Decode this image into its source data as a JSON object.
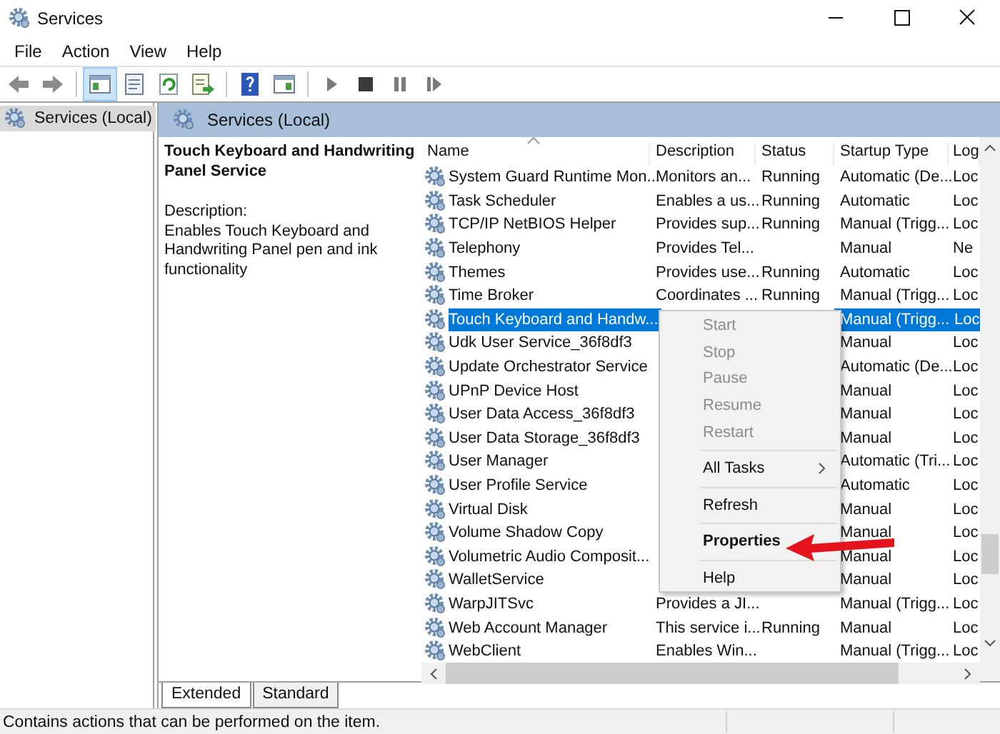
{
  "window": {
    "title": "Services"
  },
  "menu_bar": [
    "File",
    "Action",
    "View",
    "Help"
  ],
  "toolbar": [
    {
      "kind": "back",
      "selected": false
    },
    {
      "kind": "forward",
      "selected": false
    },
    {
      "kind": "sep"
    },
    {
      "kind": "tree",
      "selected": true
    },
    {
      "kind": "props",
      "selected": false
    },
    {
      "kind": "refresh",
      "selected": false
    },
    {
      "kind": "export",
      "selected": false
    },
    {
      "kind": "sep"
    },
    {
      "kind": "help",
      "selected": false
    },
    {
      "kind": "pane",
      "selected": false
    },
    {
      "kind": "sep"
    },
    {
      "kind": "play",
      "selected": false
    },
    {
      "kind": "stop",
      "selected": false
    },
    {
      "kind": "pause",
      "selected": false
    },
    {
      "kind": "resume",
      "selected": false
    }
  ],
  "tree": [
    {
      "label": "Services (Local)",
      "selected": true
    }
  ],
  "panel": {
    "title": "Services (Local)"
  },
  "details": {
    "service_name": "Touch Keyboard and Handwriting Panel Service",
    "description_label": "Description:",
    "description": "Enables Touch Keyboard and Handwriting Panel pen and ink functionality"
  },
  "table": {
    "columns": [
      {
        "label": "Name",
        "sorted": true
      },
      {
        "label": "Description",
        "sorted": false
      },
      {
        "label": "Status",
        "sorted": false
      },
      {
        "label": "Startup Type",
        "sorted": false
      },
      {
        "label": "Log",
        "sorted": false
      }
    ],
    "rows": [
      {
        "name": "System Guard Runtime Mon...",
        "description": "Monitors an...",
        "status": "Running",
        "startup": "Automatic (De...",
        "logon": "Loc",
        "selected": false
      },
      {
        "name": "Task Scheduler",
        "description": "Enables a us...",
        "status": "Running",
        "startup": "Automatic",
        "logon": "Loc",
        "selected": false
      },
      {
        "name": "TCP/IP NetBIOS Helper",
        "description": "Provides sup...",
        "status": "Running",
        "startup": "Manual (Trigg...",
        "logon": "Loc",
        "selected": false
      },
      {
        "name": "Telephony",
        "description": "Provides Tel...",
        "startup": "Manual",
        "logon": "Ne",
        "selected": false
      },
      {
        "name": "Themes",
        "description": "Provides use...",
        "status": "Running",
        "startup": "Automatic",
        "logon": "Loc",
        "selected": false
      },
      {
        "name": "Time Broker",
        "description": "Coordinates ...",
        "status": "Running",
        "startup": "Manual (Trigg...",
        "logon": "Loc",
        "selected": false
      },
      {
        "name": "Touch Keyboard and Handw...",
        "startup": "Manual (Trigg...",
        "logon": "Loc",
        "selected": true
      },
      {
        "name": "Udk User Service_36f8df3",
        "startup": "Manual",
        "logon": "Loc",
        "selected": false
      },
      {
        "name": "Update Orchestrator Service",
        "startup": "Automatic (De...",
        "logon": "Loc",
        "selected": false
      },
      {
        "name": "UPnP Device Host",
        "startup": "Manual",
        "logon": "Loc",
        "selected": false
      },
      {
        "name": "User Data Access_36f8df3",
        "startup": "Manual",
        "logon": "Loc",
        "selected": false
      },
      {
        "name": "User Data Storage_36f8df3",
        "startup": "Manual",
        "logon": "Loc",
        "selected": false
      },
      {
        "name": "User Manager",
        "startup": "Automatic (Tri...",
        "logon": "Loc",
        "selected": false
      },
      {
        "name": "User Profile Service",
        "startup": "Automatic",
        "logon": "Loc",
        "selected": false
      },
      {
        "name": "Virtual Disk",
        "startup": "Manual",
        "logon": "Loc",
        "selected": false
      },
      {
        "name": "Volume Shadow Copy",
        "startup": "Manual",
        "logon": "Loc",
        "selected": false
      },
      {
        "name": "Volumetric Audio Composit...",
        "startup": "Manual",
        "logon": "Loc",
        "selected": false
      },
      {
        "name": "WalletService",
        "startup": "Manual",
        "logon": "Loc",
        "selected": false
      },
      {
        "name": "WarpJITSvc",
        "description": "Provides a JI...",
        "startup": "Manual (Trigg...",
        "logon": "Loc",
        "selected": false
      },
      {
        "name": "Web Account Manager",
        "description": "This service i...",
        "status": "Running",
        "startup": "Manual",
        "logon": "Loc",
        "selected": false
      },
      {
        "name": "WebClient",
        "description": "Enables Win...",
        "startup": "Manual (Trigg...",
        "logon": "Loc",
        "selected": false
      }
    ]
  },
  "context_menu": [
    {
      "kind": "item",
      "label": "Start",
      "disabled": true,
      "default": false
    },
    {
      "kind": "item",
      "label": "Stop",
      "disabled": true,
      "default": false
    },
    {
      "kind": "item",
      "label": "Pause",
      "disabled": true,
      "default": false
    },
    {
      "kind": "item",
      "label": "Resume",
      "disabled": true,
      "default": false
    },
    {
      "kind": "item",
      "label": "Restart",
      "disabled": true,
      "default": false
    },
    {
      "kind": "separator"
    },
    {
      "kind": "submenu",
      "label": "All Tasks",
      "disabled": false,
      "default": false
    },
    {
      "kind": "separator"
    },
    {
      "kind": "item",
      "label": "Refresh",
      "disabled": false,
      "default": false
    },
    {
      "kind": "separator"
    },
    {
      "kind": "item",
      "label": "Properties",
      "disabled": false,
      "default": true
    },
    {
      "kind": "separator"
    },
    {
      "kind": "item",
      "label": "Help",
      "disabled": false,
      "default": false
    }
  ],
  "annotation": {
    "kind": "arrow"
  },
  "view_tabs": [
    {
      "label": "Extended",
      "selected": true
    },
    {
      "label": "Standard",
      "selected": false
    }
  ],
  "status_bar": {
    "text": "Contains actions that can be performed on the item."
  }
}
